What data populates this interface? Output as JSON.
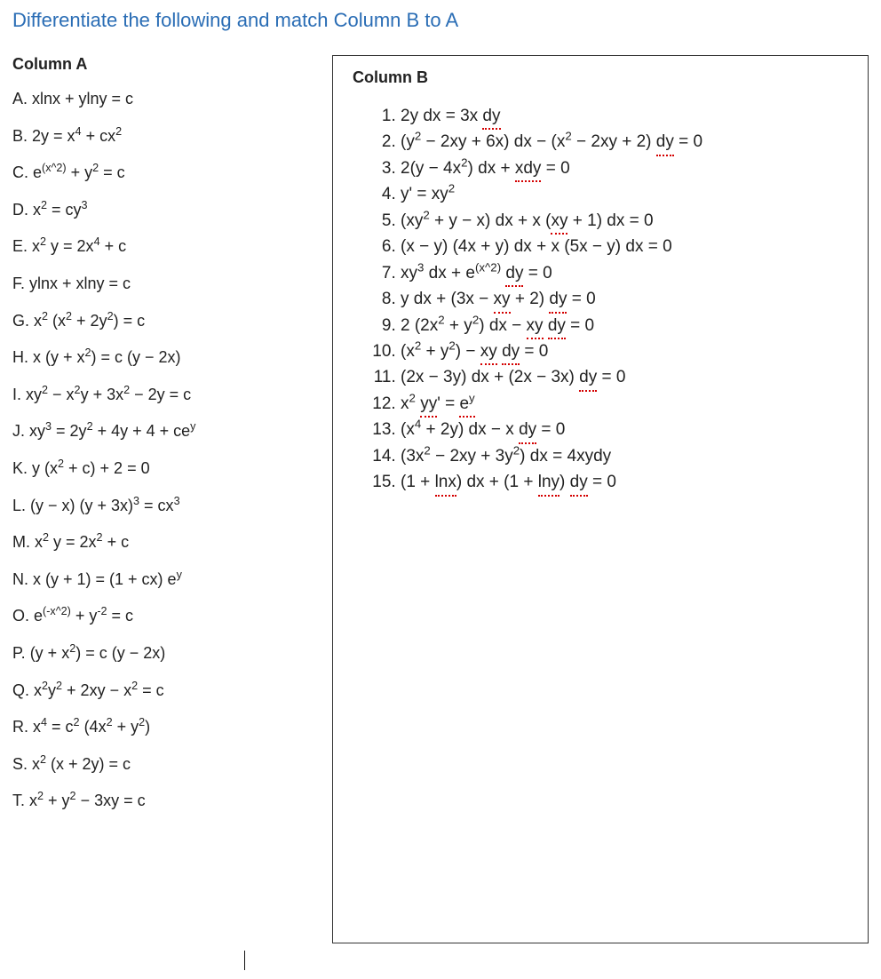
{
  "title": "Differentiate the following and match Column B to A",
  "columnA": {
    "header": "Column A",
    "items": {
      "A": "A. xlnx + ylny = c",
      "B": "B. 2y = x<sup>4</sup> + cx<sup>2</sup>",
      "C": "C. e<sup>(x^2)</sup> + y<sup>2</sup> = c",
      "D": "D. x<sup>2</sup> = cy<sup>3</sup>",
      "E": "E. x<sup>2</sup> y = 2x<sup>4</sup> + c",
      "F": "F. ylnx + xlny = c",
      "G": "G. x<sup>2</sup> (x<sup>2</sup> + 2y<sup>2</sup>) = c",
      "H": "H. x (y + x<sup>2</sup>) = c (y − 2x)",
      "I": "I. xy<sup>2</sup> − x<sup>2</sup>y + 3x<sup>2</sup> − 2y = c",
      "J": "J. xy<sup>3</sup> = 2y<sup>2</sup> + 4y + 4 + ce<sup>y</sup>",
      "K": "K. y (x<sup>2</sup> + c) + 2 = 0",
      "L": "L. (y − x) (y + 3x)<sup>3</sup> = cx<sup>3</sup>",
      "M": "M. x<sup>2</sup> y = 2x<sup>2</sup> + c",
      "N": "N. x (y + 1) = (1 + cx) e<sup>y</sup>",
      "O": "O. e<sup>(-x^2)</sup> + y<sup>-2</sup> = c",
      "P": "P. (y + x<sup>2</sup>) = c (y − 2x)",
      "Q": "Q. x<sup>2</sup>y<sup>2</sup> + 2xy − x<sup>2</sup> = c",
      "R": "R. x<sup>4</sup> = c<sup>2</sup> (4x<sup>2</sup> + y<sup>2</sup>)",
      "S": "S. x<sup>2</sup> (x + 2y) = c",
      "T": "T. x<sup>2</sup> + y<sup>2</sup> − 3xy = c"
    }
  },
  "columnB": {
    "header": "Column B",
    "items": {
      "1": "2y dx = 3x <span class=\"sq\">dy</span>",
      "2": "(y<sup>2</sup> − 2xy + 6x) dx − (x<sup>2</sup> − 2xy + 2) <span class=\"sq\">dy</span> = 0",
      "3": "2(y − 4x<sup>2</sup>) dx + <span class=\"sq\">xdy</span> = 0",
      "4": "y' = xy<sup>2</sup>",
      "5": "(xy<sup>2</sup> + y − x) dx + x (<span class=\"sq\">xy</span> + 1) dx = 0",
      "6": "(x − y) (4x + y) dx + x (5x − y) dx = 0",
      "7": "xy<sup>3</sup> dx + e<sup>(x^2)</sup> <span class=\"sq\">dy</span> = 0",
      "8": "y dx + (3x − <span class=\"sq\">xy</span> + 2) <span class=\"sq\">dy</span> = 0",
      "9": "2 (2x<sup>2</sup> + y<sup>2</sup>) dx − <span class=\"sq\">xy</span> <span class=\"sq\">dy</span> = 0",
      "10": "(x<sup>2</sup> + y<sup>2</sup>) − <span class=\"sq\">xy</span> <span class=\"sq\">dy</span> = 0",
      "11": "(2x − 3y) dx + (2x − 3x) <span class=\"sq\">dy</span> = 0",
      "12": "x<sup>2</sup> <span class=\"sq\">yy</span>' = <span class=\"sq\">e<sup>y</sup></span>",
      "13": "(x<sup>4</sup> + 2y) dx − x <span class=\"sq\">dy</span> = 0",
      "14": "(3x<sup>2</sup> − 2xy + 3y<sup>2</sup>) dx = 4xydy",
      "15": "(1 + <span class=\"sq\">lnx</span>) dx + (1 + <span class=\"sq\">lny</span>) <span class=\"sq\">dy</span> = 0"
    }
  }
}
